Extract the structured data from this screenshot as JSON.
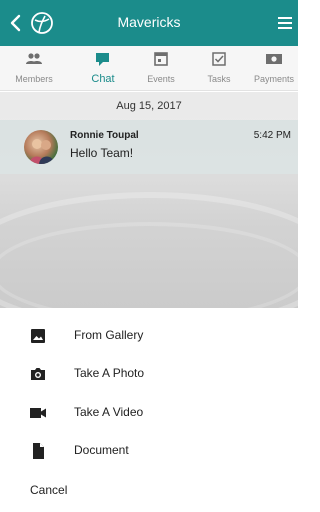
{
  "header": {
    "title": "Mavericks",
    "back_icon": "chevron-left-icon",
    "logo_icon": "team-logo-icon",
    "menu_icon": "hamburger-menu-icon",
    "color": "#1b8c8b"
  },
  "tabs": [
    {
      "label": "Members",
      "icon": "members-icon",
      "active": false
    },
    {
      "label": "Chat",
      "icon": "chat-icon",
      "active": true
    },
    {
      "label": "Events",
      "icon": "calendar-icon",
      "active": false
    },
    {
      "label": "Tasks",
      "icon": "checkbox-icon",
      "active": false
    },
    {
      "label": "Payments",
      "icon": "money-icon",
      "active": false
    }
  ],
  "chat": {
    "date": "Aug 15, 2017",
    "messages": [
      {
        "sender": "Ronnie Toupal",
        "time": "5:42 PM",
        "text": "Hello Team!"
      }
    ]
  },
  "attach_sheet": {
    "options": [
      {
        "label": "From Gallery",
        "icon": "image-icon"
      },
      {
        "label": "Take A Photo",
        "icon": "camera-icon"
      },
      {
        "label": "Take A Video",
        "icon": "video-icon"
      },
      {
        "label": "Document",
        "icon": "document-icon"
      }
    ],
    "cancel_label": "Cancel"
  }
}
